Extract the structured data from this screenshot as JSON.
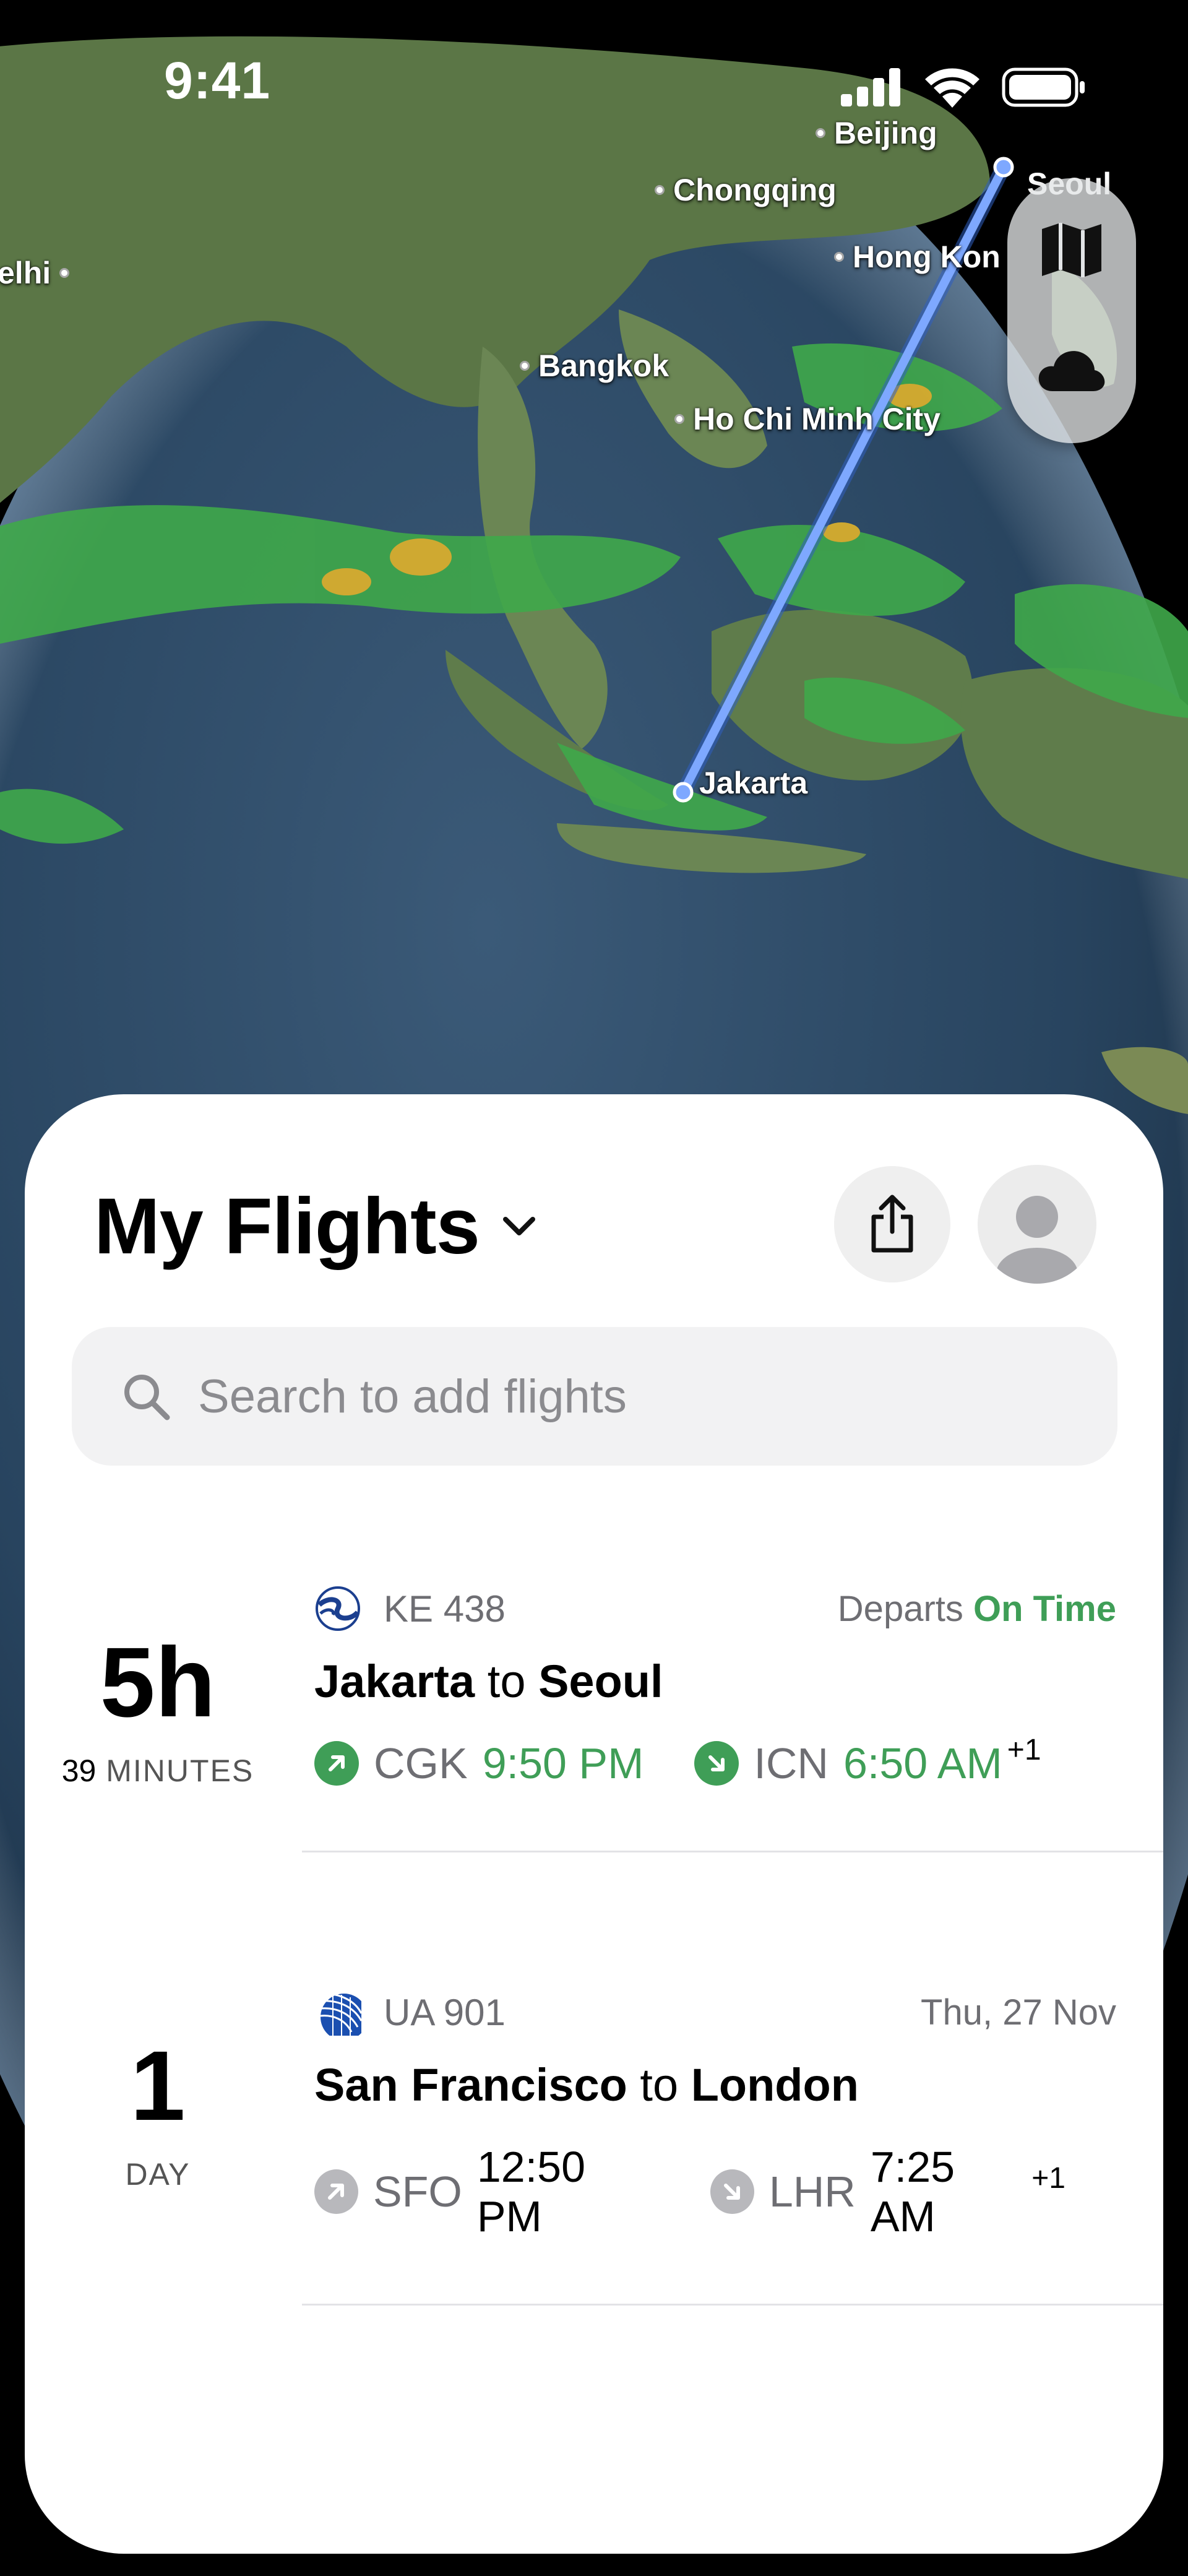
{
  "status_bar": {
    "time": "9:41"
  },
  "map": {
    "cities": [
      {
        "id": "beijing",
        "name": "Beijing"
      },
      {
        "id": "chongqing",
        "name": "Chongqing"
      },
      {
        "id": "delhi",
        "name": "elhi"
      },
      {
        "id": "hong-kong",
        "name": "Hong Kon"
      },
      {
        "id": "bangkok",
        "name": "Bangkok"
      },
      {
        "id": "ho-chi-minh",
        "name": "Ho Chi Minh City"
      },
      {
        "id": "jakarta",
        "name": "Jakarta"
      },
      {
        "id": "seoul",
        "name": "Seoul"
      }
    ],
    "controls": {
      "map_icon": "map-icon",
      "weather_icon": "cloud-icon"
    },
    "route_color": "#7ea8ff"
  },
  "sheet": {
    "title": "My Flights",
    "share_icon": "share-icon",
    "avatar_icon": "person-icon"
  },
  "search": {
    "placeholder": "Search to add flights"
  },
  "flights": [
    {
      "countdown_value": "5h",
      "countdown_minutes": "39",
      "countdown_unit": "MINUTES",
      "airline_icon": "korean-air-logo",
      "flight_number": "KE 438",
      "status_prefix": "Departs",
      "status_value": "On Time",
      "origin_city": "Jakarta",
      "to": "to",
      "destination_city": "Seoul",
      "departure_code": "CGK",
      "departure_time": "9:50 PM",
      "arrival_code": "ICN",
      "arrival_time": "6:50 AM",
      "day_offset": "+1"
    },
    {
      "countdown_value": "1",
      "countdown_unit": "DAY",
      "airline_icon": "united-logo",
      "flight_number": "UA 901",
      "status_prefix": "Thu, 27 Nov",
      "origin_city": "San Francisco",
      "to": "to",
      "destination_city": "London",
      "departure_code": "SFO",
      "departure_time": "12:50 PM",
      "arrival_code": "LHR",
      "arrival_time": "7:25 AM",
      "day_offset": "+1"
    }
  ],
  "colors": {
    "on_time_green": "#3f9e57",
    "inactive_gray": "#b8b8bc"
  }
}
